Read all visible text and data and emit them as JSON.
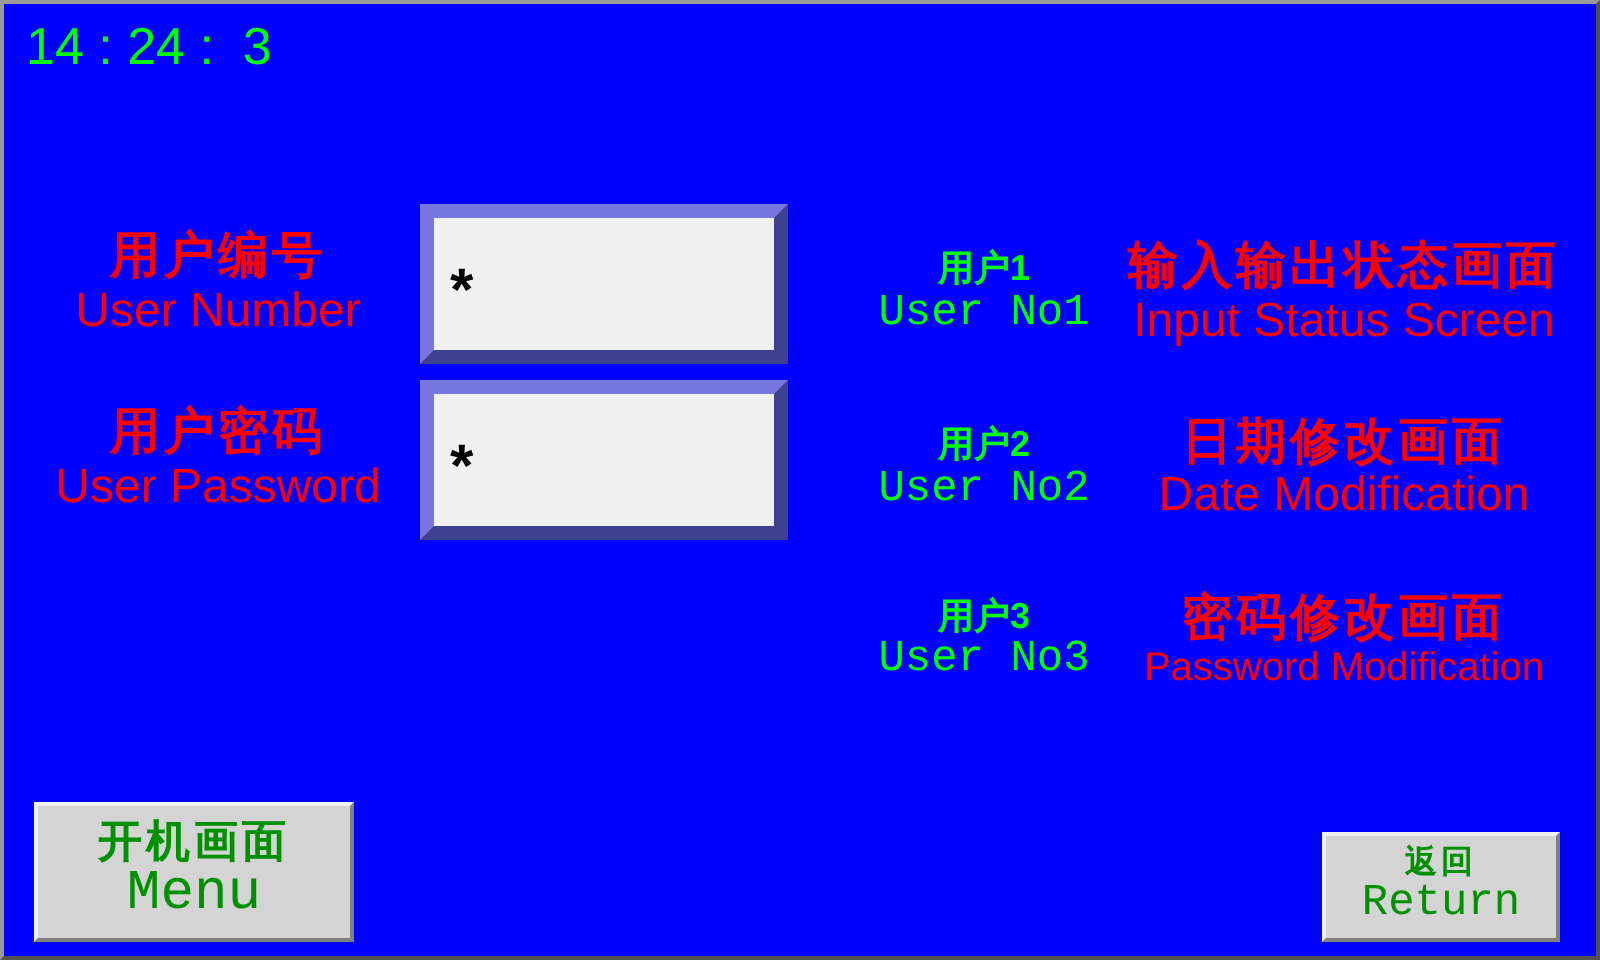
{
  "clock": "14 : 24 :  3",
  "login_fields": [
    {
      "label_zh": "用户编号",
      "label_en": "User Number",
      "value": "*"
    },
    {
      "label_zh": "用户密码",
      "label_en": "User Password",
      "value": "*"
    }
  ],
  "users": [
    {
      "name_zh": "用户1",
      "name_en": "User No1",
      "screen_zh": "输入输出状态画面",
      "screen_en": "Input Status Screen"
    },
    {
      "name_zh": "用户2",
      "name_en": "User No2",
      "screen_zh": "日期修改画面",
      "screen_en": "Date Modification"
    },
    {
      "name_zh": "用户3",
      "name_en": "User No3",
      "screen_zh": "密码修改画面",
      "screen_en": "Password Modification"
    }
  ],
  "buttons": [
    {
      "kind": "large",
      "label_zh": "开机画面",
      "label_en": "Menu"
    },
    {
      "kind": "small",
      "label_zh": "返回",
      "label_en": "Return"
    }
  ]
}
